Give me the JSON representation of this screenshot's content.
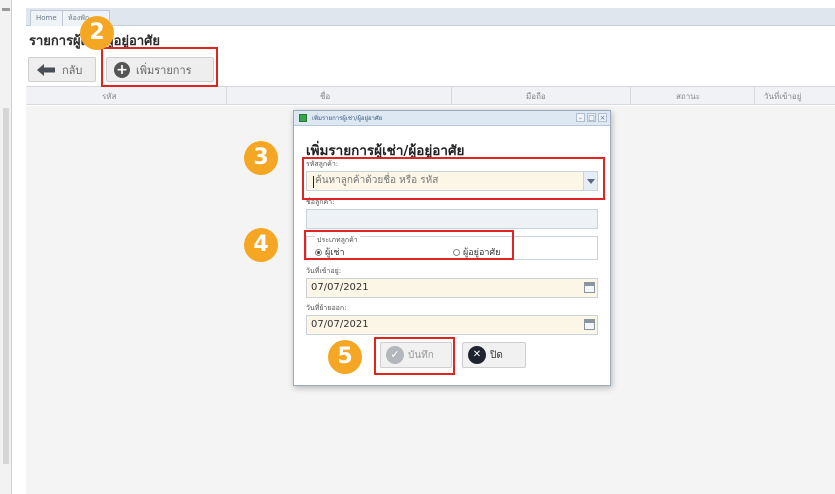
{
  "tabs": [
    "Home",
    "ห้องพัก"
  ],
  "page_title": "รายการผู้เช่า/ผู้อยู่อาศัย",
  "toolbar": {
    "back_label": "กลับ",
    "add_label": "เพิ่มรายการ"
  },
  "table": {
    "columns": [
      "รหัส",
      "ชื่อ",
      "มือถือ",
      "สถานะ",
      "วันที่เข้าอยู่"
    ]
  },
  "dialog": {
    "window_title": "เพิ่มรายการผู้เช่า/ผู้อยู่อาศัย",
    "heading": "เพิ่มรายการผู้เช่า/ผู้อยู่อาศัย",
    "customer_code_label": "รหัสลูกค้า:",
    "customer_code_placeholder": "ค้นหาลูกค้าด้วยชื่อ หรือ รหัส",
    "customer_name_label": "ชื่อลูกค้า:",
    "customer_type_label": "ประเภทลูกค้า",
    "customer_type_options": [
      "ผู้เช่า",
      "ผู้อยู่อาศัย"
    ],
    "customer_type_selected": "ผู้เช่า",
    "move_in_label": "วันที่เข้าอยู่:",
    "move_in_value": "07/07/2021",
    "move_out_label": "วันที่ย้ายออก:",
    "move_out_value": "07/07/2021",
    "save_label": "บันทึก",
    "close_label": "ปิด"
  },
  "annotations": {
    "steps": [
      "2",
      "3",
      "4",
      "5"
    ],
    "badge_color": "#f5a623",
    "highlight_color": "#e02424"
  },
  "icons": [
    "back-arrow-icon",
    "plus-circle-icon",
    "chevron-down-icon",
    "calendar-icon",
    "check-circle-icon",
    "close-circle-icon"
  ]
}
